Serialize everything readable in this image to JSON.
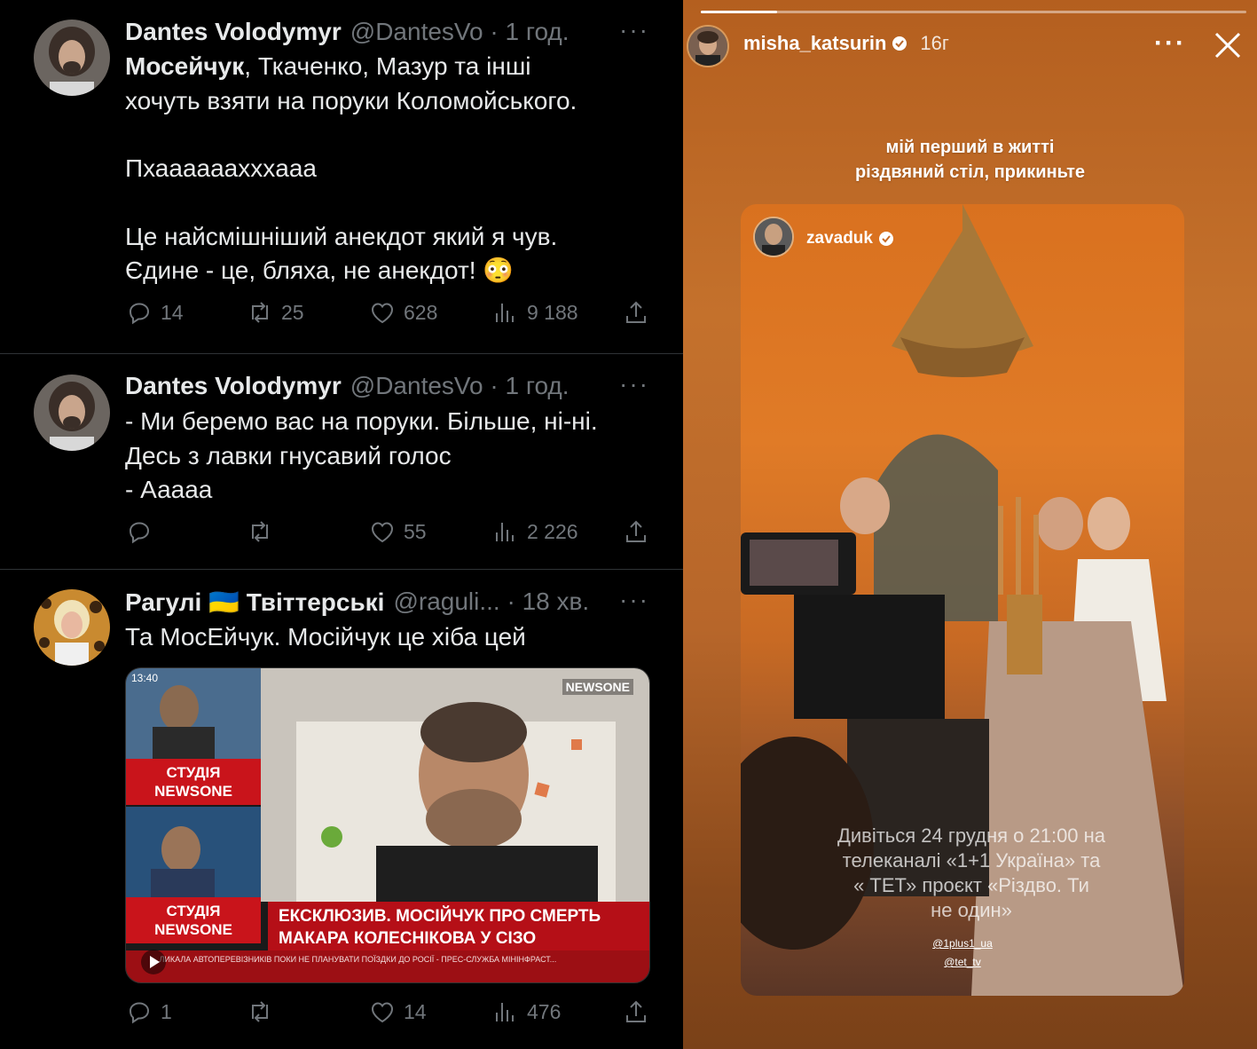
{
  "tweets": [
    {
      "name": "Dantes Volodymyr",
      "handle": "@DantesVo",
      "sep": "·",
      "time": "1 год.",
      "more": "···",
      "bold_start": "Мосейчук",
      "text_lines": [
        ", Ткаченко, Мазур  та інші",
        "хочуть взяти на поруки Коломойського.",
        "",
        "Пхааааааххxааа",
        "",
        "Це найсмішніший анекдот який я чув.",
        "Єдине - це, бляха, не анекдот! 😳"
      ],
      "replies": "14",
      "retweets": "25",
      "likes": "628",
      "views": "9 188"
    },
    {
      "name": "Dantes Volodymyr",
      "handle": "@DantesVo",
      "sep": "·",
      "time": "1 год.",
      "more": "···",
      "text_lines": [
        "- Ми беремо вас на поруки. Більше, ні-ні.",
        "Десь з лавки гнусавий голос",
        "- Ааааа"
      ],
      "replies": "",
      "retweets": "",
      "likes": "55",
      "views": "2 226"
    },
    {
      "name": "Рагулі",
      "flag": "🇺🇦",
      "name2": "Твіттерські",
      "handle": "@raguli...",
      "sep": "·",
      "time": "18 хв.",
      "more": "···",
      "text_lines": [
        "Та МосЕйчук. Мосійчук це хіба цей"
      ],
      "replies": "1",
      "retweets": "",
      "likes": "14",
      "views": "476"
    }
  ],
  "video": {
    "clock": "13:40",
    "channel_logo": "NEWSONE",
    "studio_label_1": "СТУДІЯ\nNEWSONE",
    "studio_label_2": "СТУДІЯ\nNEWSONE",
    "headline_1": "ЕКСКЛЮЗИВ. МОСІЙЧУК ПРО СМЕРТЬ",
    "headline_2": "МАКАРА КОЛЕСНІКОВА У СІЗО",
    "crawl": "...ЛИКАЛА АВТОПЕРЕВІЗНИКІВ ПОКИ НЕ ПЛАНУВАТИ ПОЇЗДКИ ДО РОСІЇ - ПРЕС-СЛУЖБА МІНІНФРАСТ..."
  },
  "story": {
    "username": "misha_katsurin",
    "time": "16г",
    "more": "···",
    "caption_line1": "мій перший в житті",
    "caption_line2": "різдвяний стіл, прикиньте",
    "progress": 0.14,
    "inner": {
      "username": "zavaduk",
      "overlay_line1": "Дивіться 24 грудня о 21:00 на",
      "overlay_line2": "телеканалі «1+1 Україна» та",
      "overlay_line3": "« ТЕТ» проєкт «Різдво. Ти",
      "overlay_line4": "не один»",
      "mention1": "@1plus1_ua",
      "mention2": "@tet_tv"
    }
  },
  "colors": {
    "twitter_bg": "#000000",
    "twitter_text": "#e7e9ea",
    "twitter_muted": "#71767b",
    "divider": "#2f3336",
    "story_bg": "#c4712c",
    "news_red": "#c9141b"
  }
}
